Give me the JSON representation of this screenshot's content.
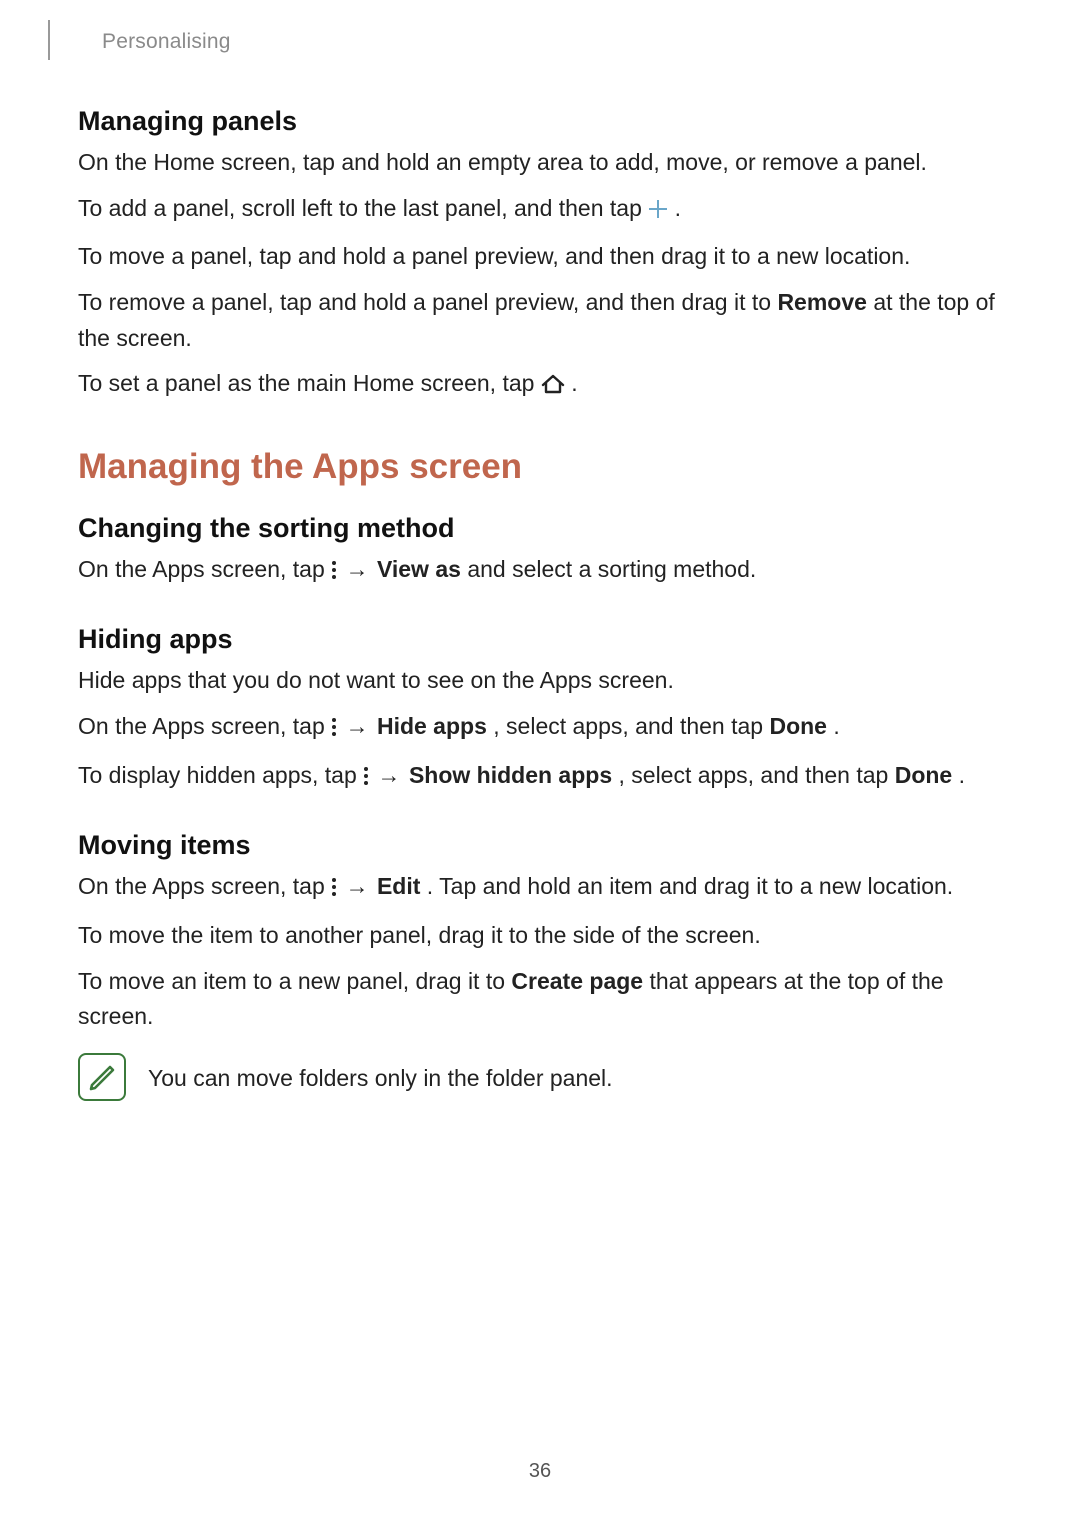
{
  "header": {
    "section_label": "Personalising"
  },
  "s1": {
    "heading": "Managing panels",
    "p1": "On the Home screen, tap and hold an empty area to add, move, or remove a panel.",
    "p2_a": "To add a panel, scroll left to the last panel, and then tap ",
    "p2_b": ".",
    "p3": "To move a panel, tap and hold a panel preview, and then drag it to a new location.",
    "p4_a": "To remove a panel, tap and hold a panel preview, and then drag it to ",
    "p4_bold": "Remove",
    "p4_b": " at the top of the screen.",
    "p5_a": "To set a panel as the main Home screen, tap ",
    "p5_b": "."
  },
  "s2": {
    "heading": "Managing the Apps screen"
  },
  "s2a": {
    "heading": "Changing the sorting method",
    "p1_a": "On the Apps screen, tap ",
    "arrow": " → ",
    "p1_bold": "View as",
    "p1_b": " and select a sorting method."
  },
  "s2b": {
    "heading": "Hiding apps",
    "p1": "Hide apps that you do not want to see on the Apps screen.",
    "p2_a": "On the Apps screen, tap ",
    "arrow": " → ",
    "p2_bold": "Hide apps",
    "p2_b": ", select apps, and then tap ",
    "p2_bold2": "Done",
    "p2_c": ".",
    "p3_a": "To display hidden apps, tap ",
    "p3_bold": "Show hidden apps",
    "p3_b": ", select apps, and then tap ",
    "p3_bold2": "Done",
    "p3_c": "."
  },
  "s2c": {
    "heading": "Moving items",
    "p1_a": "On the Apps screen, tap ",
    "arrow": " → ",
    "p1_bold": "Edit",
    "p1_b": ". Tap and hold an item and drag it to a new location.",
    "p2": "To move the item to another panel, drag it to the side of the screen.",
    "p3_a": "To move an item to a new panel, drag it to ",
    "p3_bold": "Create page",
    "p3_b": " that appears at the top of the screen.",
    "note": "You can move folders only in the folder panel."
  },
  "page_number": "36"
}
